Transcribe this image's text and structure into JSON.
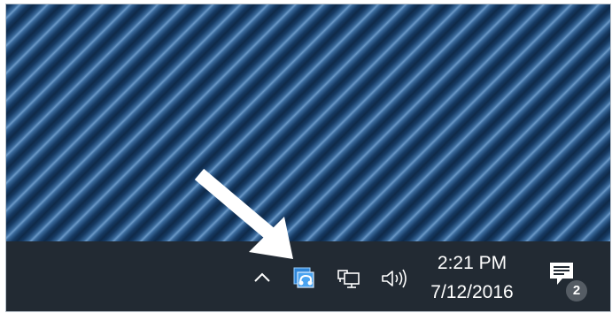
{
  "taskbar": {
    "tray": {
      "show_hidden_icons": "chevron-up-icon",
      "app_icon": "app-tray-icon",
      "network_icon": "network-icon",
      "volume_icon": "volume-icon"
    },
    "clock": {
      "time": "2:21 PM",
      "date": "7/12/2016"
    },
    "action_center": {
      "icon": "action-center-icon",
      "badge_count": "2"
    }
  },
  "annotation": {
    "arrow_icon": "pointer-arrow-icon",
    "color": "#ffffff"
  },
  "colors": {
    "taskbar_bg": "#222a33",
    "desktop_stripe_dark": "#0f2a49",
    "desktop_stripe_light": "#6d9ac8"
  }
}
